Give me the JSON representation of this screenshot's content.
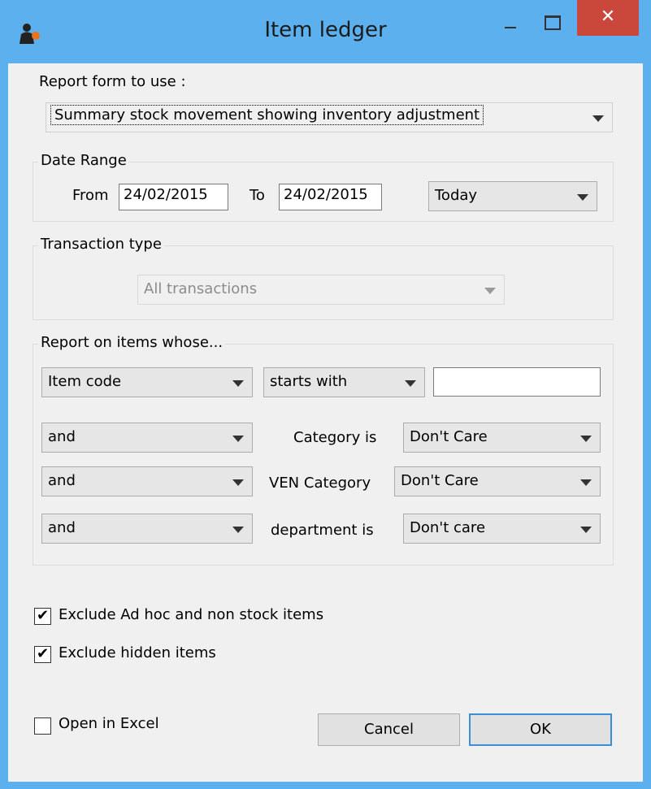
{
  "window": {
    "title": "Item ledger",
    "close_glyph": "✕",
    "icons": {
      "app": "app-person-icon",
      "minimize": "minimize-icon",
      "maximize": "maximize-icon",
      "close": "close-icon"
    }
  },
  "report_form": {
    "label": "Report form to use :",
    "value": "Summary stock movement showing inventory adjustment"
  },
  "date_range": {
    "title": "Date Range",
    "from_label": "From",
    "from_value": "24/02/2015",
    "to_label": "To",
    "to_value": "24/02/2015",
    "preset": "Today"
  },
  "transaction_type": {
    "title": "Transaction type",
    "value": "All transactions"
  },
  "filters": {
    "title": "Report on items whose...",
    "field": "Item code",
    "operator": "starts with",
    "text_value": "",
    "rows": [
      {
        "conj": "and",
        "label": "Category is",
        "value": "Don't Care"
      },
      {
        "conj": "and",
        "label": "VEN Category",
        "value": "Don't Care"
      },
      {
        "conj": "and",
        "label": "department is",
        "value": "Don't care"
      }
    ]
  },
  "options": {
    "exclude_adhoc": {
      "label": "Exclude Ad hoc and non stock items",
      "checked": true
    },
    "exclude_hidden": {
      "label": "Exclude hidden items",
      "checked": true
    },
    "open_excel": {
      "label": "Open in Excel",
      "checked": false
    }
  },
  "buttons": {
    "cancel": "Cancel",
    "ok": "OK"
  },
  "check_glyph": "✔",
  "colors": {
    "titlebar": "#5cb0ee",
    "close": "#c9473b",
    "dialog_bg": "#f0f0f0",
    "default_button_border": "#3c8fd6"
  }
}
